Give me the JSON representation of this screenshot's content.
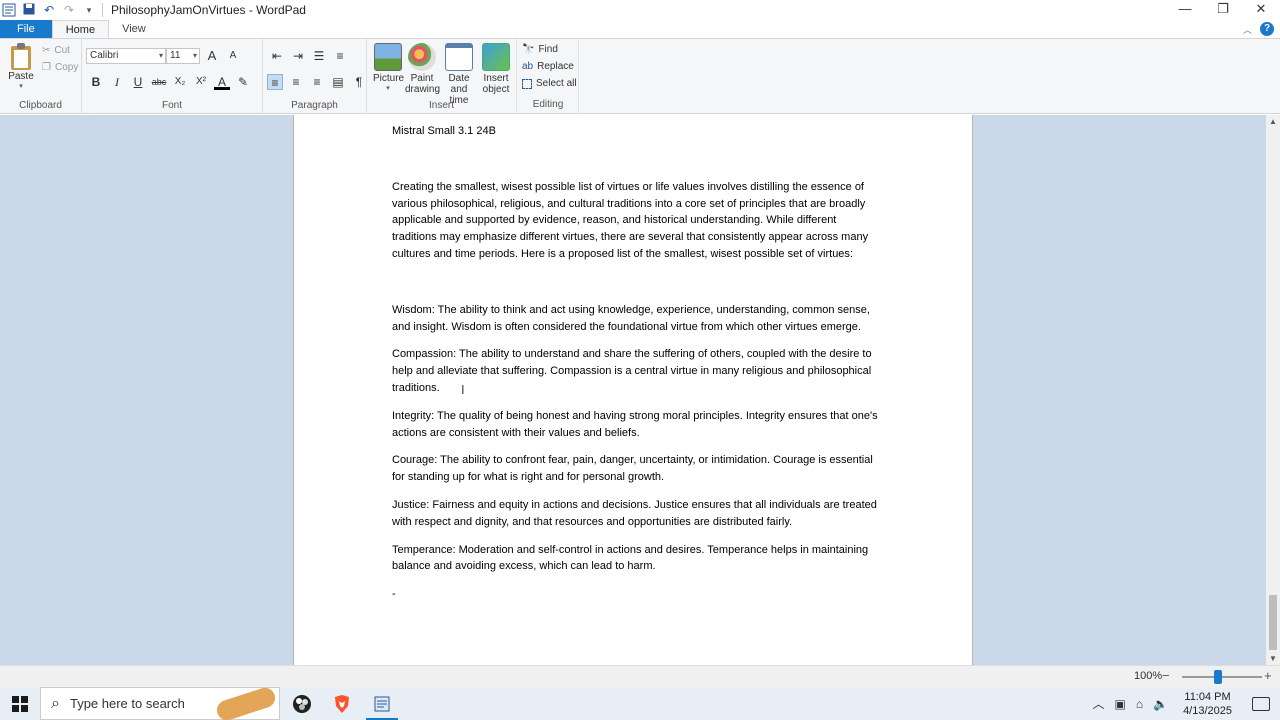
{
  "window": {
    "title": "PhilosophyJamOnVirtues - WordPad",
    "controls": {
      "minimize": "—",
      "restore": "❐",
      "close": "✕"
    }
  },
  "quick_access": {
    "save": "💾",
    "undo": "↶",
    "redo": "↷",
    "customize": "▾"
  },
  "tabs": [
    "File",
    "Home",
    "View"
  ],
  "ribbon": {
    "clipboard": {
      "paste": "Paste",
      "cut": "Cut",
      "copy": "Copy",
      "label": "Clipboard"
    },
    "font": {
      "family": "Calibri",
      "size": "11",
      "label": "Font",
      "grow": "A",
      "shrink": "A",
      "bold": "B",
      "italic": "I",
      "underline": "U",
      "strike": "abc",
      "sub": "X₂",
      "sup": "X²",
      "color": "A",
      "highlight": "✎"
    },
    "paragraph": {
      "label": "Paragraph"
    },
    "insert": {
      "label": "Insert",
      "picture": "Picture",
      "paint": "Paint\ndrawing",
      "paint_l1": "Paint",
      "paint_l2": "drawing",
      "date_l1": "Date and",
      "date_l2": "time",
      "obj_l1": "Insert",
      "obj_l2": "object"
    },
    "editing": {
      "label": "Editing",
      "find": "Find",
      "replace": "Replace",
      "select_all": "Select all"
    }
  },
  "document": {
    "heading": "Mistral Small 3.1 24B",
    "intro": "Creating the smallest, wisest possible list of virtues or life values involves distilling the essence of various philosophical, religious, and cultural traditions into a core set of principles that are broadly applicable and supported by evidence, reason, and historical understanding. While different traditions may emphasize different virtues, there are several that consistently appear across many cultures and time periods. Here is a proposed list of the smallest, wisest possible set of virtues:",
    "virtues": [
      "Wisdom: The ability to think and act using knowledge, experience, understanding, common sense, and insight. Wisdom is often considered the foundational virtue from which other virtues emerge.",
      "Compassion: The ability to understand and share the suffering of others, coupled with the desire to help and alleviate that suffering. Compassion is a central virtue in many religious and philosophical traditions.",
      "Integrity: The quality of being honest and having strong moral principles. Integrity ensures that one's actions are consistent with their values and beliefs.",
      "Courage: The ability to confront fear, pain, danger, uncertainty, or intimidation. Courage is essential for standing up for what is right and for personal growth.",
      "Justice: Fairness and equity in actions and decisions. Justice ensures that all individuals are treated with respect and dignity, and that resources and opportunities are distributed fairly.",
      "Temperance: Moderation and self-control in actions and desires. Temperance helps in maintaining balance and avoiding excess, which can lead to harm."
    ],
    "trailing": "-"
  },
  "status": {
    "zoom": "100%",
    "minus": "−",
    "plus": "+"
  },
  "taskbar": {
    "search_placeholder": "Type here to search",
    "time": "11:04 PM",
    "date": "4/13/2025"
  },
  "colors": {
    "accent": "#1979ca",
    "doc_bg": "#cad8ea",
    "ribbon_bg": "#f5f6f7"
  }
}
